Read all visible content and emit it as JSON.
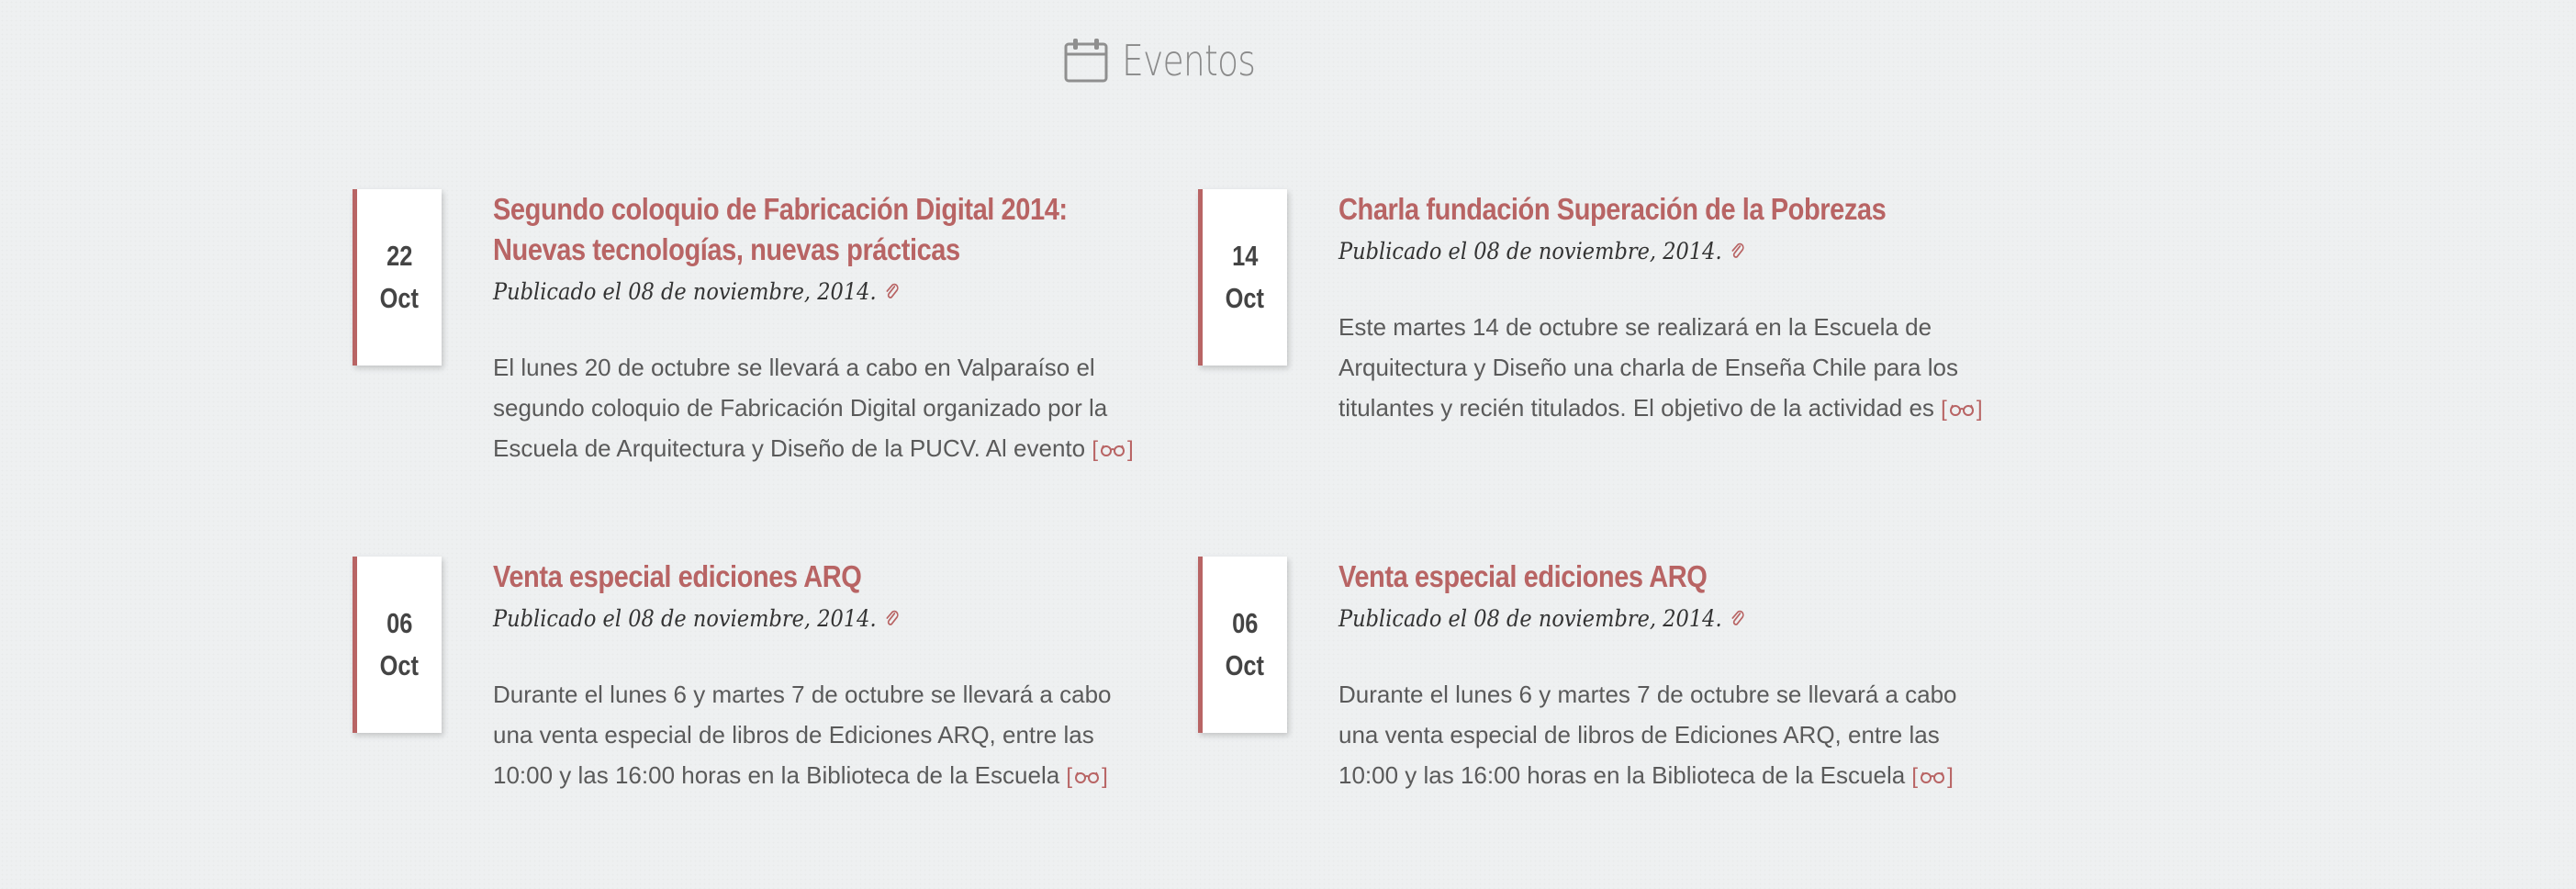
{
  "section": {
    "title": "Eventos",
    "icon": "calendar-icon"
  },
  "colors": {
    "accent": "#b86464",
    "background": "#eef0f1",
    "text": "#5a5a5a"
  },
  "events": [
    {
      "day": "22",
      "month": "Oct",
      "title": "Segundo coloquio de Fabricación Digital 2014: Nuevas tecnologías, nuevas prácticas",
      "meta": "Publicado el 08 de noviembre, 2014.",
      "excerpt": "El lunes 20 de octubre se llevará a cabo en Valparaíso el segundo coloquio de Fabricación Digital organizado por la Escuela de Arquitectura y Diseño de la PUCV. Al evento",
      "more_open": "[",
      "more_close": "]",
      "more_icon": "glasses-icon"
    },
    {
      "day": "14",
      "month": "Oct",
      "title": "Charla fundación Superación de la Pobrezas",
      "meta": "Publicado el 08 de noviembre, 2014.",
      "excerpt": "Este martes 14 de octubre se realizará en la Escuela de Arquitectura y Diseño una charla de Enseña Chile para los titulantes y recién titulados. El objetivo de la actividad es",
      "more_open": "[",
      "more_close": "]",
      "more_icon": "glasses-icon"
    },
    {
      "day": "06",
      "month": "Oct",
      "title": "Venta especial ediciones ARQ",
      "meta": "Publicado el 08 de noviembre, 2014.",
      "excerpt": "Durante el lunes 6 y martes 7 de octubre se llevará a cabo una venta especial de libros de Ediciones ARQ, entre las 10:00 y las 16:00 horas en la Biblioteca de la Escuela",
      "more_open": "[",
      "more_close": "]",
      "more_icon": "glasses-icon"
    },
    {
      "day": "06",
      "month": "Oct",
      "title": "Venta especial ediciones ARQ",
      "meta": "Publicado el 08 de noviembre, 2014.",
      "excerpt": "Durante el lunes 6 y martes 7 de octubre se llevará a cabo una venta especial de libros de Ediciones ARQ, entre las 10:00 y las 16:00 horas en la Biblioteca de la Escuela",
      "more_open": "[",
      "more_close": "]",
      "more_icon": "glasses-icon"
    }
  ]
}
